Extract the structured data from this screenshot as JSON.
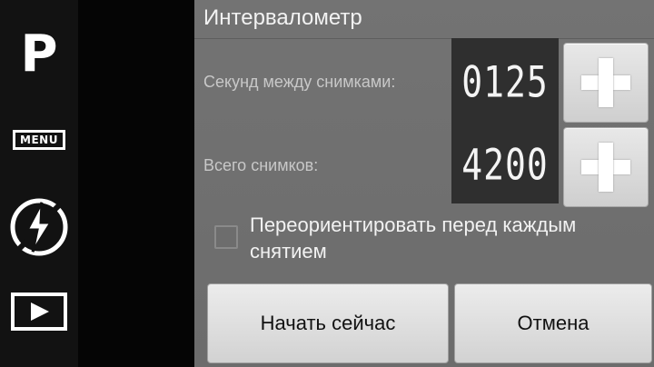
{
  "toolbar": {
    "mode_letter": "P",
    "menu_label": "MENU",
    "icons": [
      "menu-icon",
      "flash-auto-icon",
      "playback-icon"
    ]
  },
  "dialog": {
    "title": "Интервалометр",
    "seconds_label": "Секунд между снимками:",
    "seconds_value": "0125",
    "total_label": "Всего снимков:",
    "total_value": "4200",
    "reorient_label": "Переориентировать перед каждым снятием",
    "reorient_checked": false,
    "start_button": "Начать сейчас",
    "cancel_button": "Отмена"
  },
  "colors": {
    "dialog_bg": "#737373",
    "display_bg": "#2f2f2f",
    "button_bg": "#e0e0e0"
  }
}
